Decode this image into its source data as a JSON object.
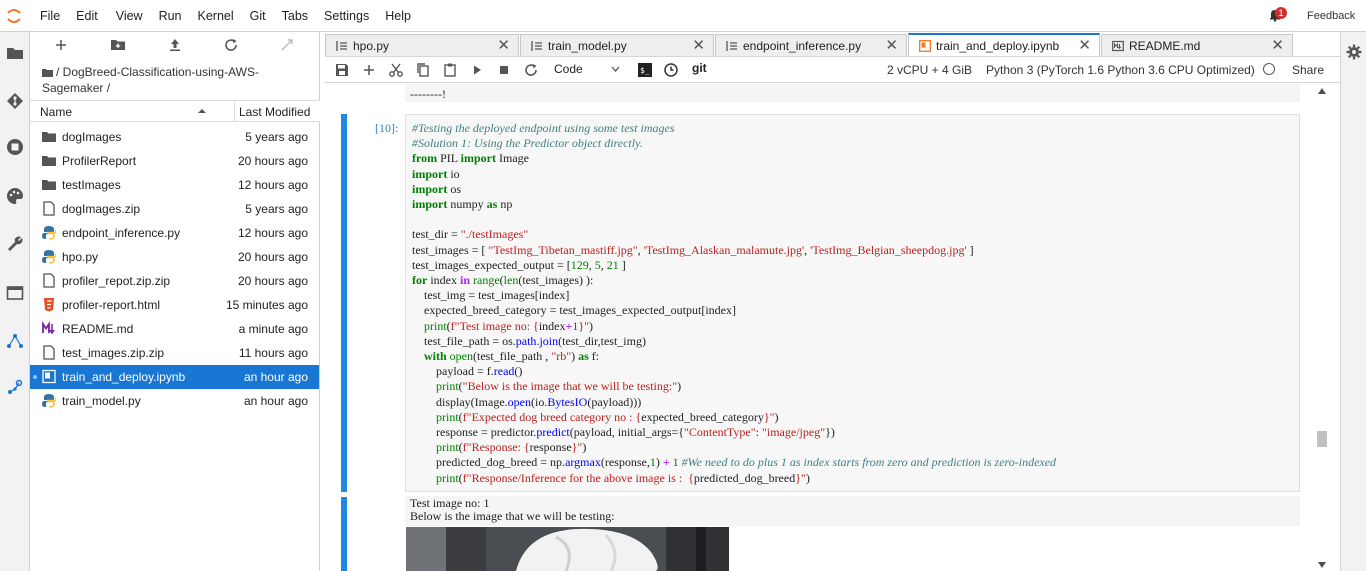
{
  "menubar": {
    "items": [
      "File",
      "Edit",
      "View",
      "Run",
      "Kernel",
      "Git",
      "Tabs",
      "Settings",
      "Help"
    ],
    "notification_count": "1",
    "feedback_label": "Feedback"
  },
  "filebrowser": {
    "breadcrumb": "/ DogBreed-Classification-using-AWS-Sagemaker /",
    "col_name": "Name",
    "col_modified": "Last Modified",
    "files": [
      {
        "name": "dogImages",
        "modified": "5 years ago",
        "icon": "folder-icon"
      },
      {
        "name": "ProfilerReport",
        "modified": "20 hours ago",
        "icon": "folder-icon"
      },
      {
        "name": "testImages",
        "modified": "12 hours ago",
        "icon": "folder-icon"
      },
      {
        "name": "dogImages.zip",
        "modified": "5 years ago",
        "icon": "file-icon"
      },
      {
        "name": "endpoint_inference.py",
        "modified": "12 hours ago",
        "icon": "python-icon"
      },
      {
        "name": "hpo.py",
        "modified": "20 hours ago",
        "icon": "python-icon"
      },
      {
        "name": "profiler_repot.zip.zip",
        "modified": "20 hours ago",
        "icon": "file-icon"
      },
      {
        "name": "profiler-report.html",
        "modified": "15 minutes ago",
        "icon": "html-icon"
      },
      {
        "name": "README.md",
        "modified": "a minute ago",
        "icon": "markdown-icon"
      },
      {
        "name": "test_images.zip.zip",
        "modified": "11 hours ago",
        "icon": "file-icon"
      },
      {
        "name": "train_and_deploy.ipynb",
        "modified": "an hour ago",
        "icon": "notebook-icon"
      },
      {
        "name": "train_model.py",
        "modified": "an hour ago",
        "icon": "python-icon"
      }
    ]
  },
  "tabs": [
    {
      "label": "hpo.py",
      "icon": "python-icon"
    },
    {
      "label": "train_model.py",
      "icon": "python-icon"
    },
    {
      "label": "endpoint_inference.py",
      "icon": "python-icon"
    },
    {
      "label": "train_and_deploy.ipynb",
      "icon": "notebook-icon"
    },
    {
      "label": "README.md",
      "icon": "markdown-icon"
    }
  ],
  "toolbar": {
    "cell_type": "Code",
    "git_label": "git",
    "instance": "2 vCPU + 4 GiB",
    "kernel": "Python 3 (PyTorch 1.6 Python 3.6 CPU Optimized)",
    "share": "Share"
  },
  "notebook": {
    "prev_output": "--------!",
    "prompt": "[10]:",
    "output_line1": "Test image no: 1",
    "output_line2": "Below is the image that we will be testing:"
  },
  "colors": {
    "accent": "#1976d2",
    "cell_bar": "#1e88e5"
  }
}
